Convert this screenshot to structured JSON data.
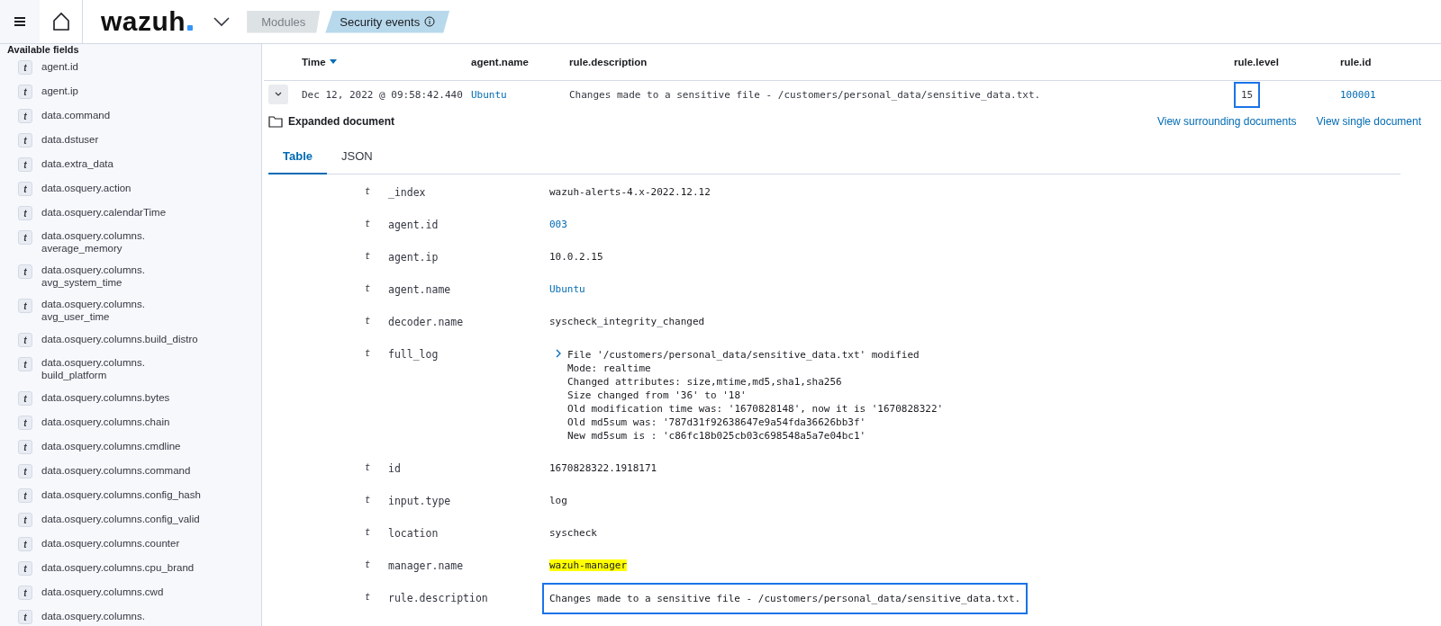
{
  "header": {
    "brand": "wazuh",
    "breadcrumbs": [
      {
        "label": "Modules",
        "selected": false
      },
      {
        "label": "Security events",
        "selected": true
      }
    ]
  },
  "sidebar": {
    "title": "Available fields",
    "fields": [
      {
        "type": "t",
        "lines": [
          "agent.id"
        ]
      },
      {
        "type": "t",
        "lines": [
          "agent.ip"
        ]
      },
      {
        "type": "t",
        "lines": [
          "data.command"
        ]
      },
      {
        "type": "t",
        "lines": [
          "data.dstuser"
        ]
      },
      {
        "type": "t",
        "lines": [
          "data.extra_data"
        ]
      },
      {
        "type": "t",
        "lines": [
          "data.osquery.action"
        ]
      },
      {
        "type": "t",
        "lines": [
          "data.osquery.calendarTime"
        ]
      },
      {
        "type": "t",
        "lines": [
          "data.osquery.columns.",
          "average_memory"
        ]
      },
      {
        "type": "t",
        "lines": [
          "data.osquery.columns.",
          "avg_system_time"
        ]
      },
      {
        "type": "t",
        "lines": [
          "data.osquery.columns.",
          "avg_user_time"
        ]
      },
      {
        "type": "t",
        "lines": [
          "data.osquery.columns.build_distro"
        ]
      },
      {
        "type": "t",
        "lines": [
          "data.osquery.columns.",
          "build_platform"
        ]
      },
      {
        "type": "t",
        "lines": [
          "data.osquery.columns.bytes"
        ]
      },
      {
        "type": "t",
        "lines": [
          "data.osquery.columns.chain"
        ]
      },
      {
        "type": "t",
        "lines": [
          "data.osquery.columns.cmdline"
        ]
      },
      {
        "type": "t",
        "lines": [
          "data.osquery.columns.command"
        ]
      },
      {
        "type": "t",
        "lines": [
          "data.osquery.columns.config_hash"
        ]
      },
      {
        "type": "t",
        "lines": [
          "data.osquery.columns.config_valid"
        ]
      },
      {
        "type": "t",
        "lines": [
          "data.osquery.columns.counter"
        ]
      },
      {
        "type": "t",
        "lines": [
          "data.osquery.columns.cpu_brand"
        ]
      },
      {
        "type": "t",
        "lines": [
          "data.osquery.columns.cwd"
        ]
      },
      {
        "type": "t",
        "lines": [
          "data.osquery.columns."
        ]
      }
    ]
  },
  "table": {
    "columns": [
      {
        "label": "Time",
        "sorted": true
      },
      {
        "label": "agent.name",
        "sorted": false
      },
      {
        "label": "rule.description",
        "sorted": false
      },
      {
        "label": "rule.level",
        "sorted": false
      },
      {
        "label": "rule.id",
        "sorted": false
      }
    ],
    "rows": [
      {
        "expanded": true,
        "cells": [
          {
            "kind": "text",
            "text": "Dec 12, 2022 @ 09:58:42.440",
            "outlined": false
          },
          {
            "kind": "link",
            "text": "Ubuntu",
            "outlined": false
          },
          {
            "kind": "text",
            "text": "Changes made to a sensitive file - /customers/personal_data/sensitive_data.txt.",
            "outlined": false
          },
          {
            "kind": "text",
            "text": "15",
            "outlined": true
          },
          {
            "kind": "link",
            "text": "100001",
            "outlined": false
          }
        ]
      }
    ]
  },
  "document": {
    "title": "Expanded document",
    "links": [
      "View surrounding documents",
      "View single document"
    ],
    "tabs": [
      {
        "label": "Table",
        "selected": true
      },
      {
        "label": "JSON",
        "selected": false
      }
    ],
    "fields": [
      {
        "type": "t",
        "name": "_index",
        "kind": "text",
        "value": [
          "wazuh-alerts-4.x-2022.12.12"
        ],
        "highlighted": false,
        "outlined": false
      },
      {
        "type": "t",
        "name": "agent.id",
        "kind": "link",
        "value": [
          "003"
        ],
        "highlighted": false,
        "outlined": false
      },
      {
        "type": "t",
        "name": "agent.ip",
        "kind": "text",
        "value": [
          "10.0.2.15"
        ],
        "highlighted": false,
        "outlined": false
      },
      {
        "type": "t",
        "name": "agent.name",
        "kind": "link",
        "value": [
          "Ubuntu"
        ],
        "highlighted": false,
        "outlined": false
      },
      {
        "type": "t",
        "name": "decoder.name",
        "kind": "text",
        "value": [
          "syscheck_integrity_changed"
        ],
        "highlighted": false,
        "outlined": false
      },
      {
        "type": "t",
        "name": "full_log",
        "kind": "log",
        "value": [
          "File '/customers/personal_data/sensitive_data.txt' modified",
          "Mode: realtime",
          "Changed attributes: size,mtime,md5,sha1,sha256",
          "Size changed from '36' to '18'",
          "Old modification time was: '1670828148', now it is '1670828322'",
          "Old md5sum was: '787d31f92638647e9a54fda36626bb3f'",
          "New md5sum is : 'c86fc18b025cb03c698548a5a7e04bc1'"
        ]
      },
      {
        "type": "t",
        "name": "id",
        "kind": "text",
        "value": [
          "1670828322.1918171"
        ],
        "highlighted": false,
        "outlined": false
      },
      {
        "type": "t",
        "name": "input.type",
        "kind": "text",
        "value": [
          "log"
        ],
        "highlighted": false,
        "outlined": false
      },
      {
        "type": "t",
        "name": "location",
        "kind": "text",
        "value": [
          "syscheck"
        ],
        "highlighted": false,
        "outlined": false
      },
      {
        "type": "t",
        "name": "manager.name",
        "kind": "text",
        "value": [
          "wazuh-manager"
        ],
        "highlighted": true,
        "outlined": false
      },
      {
        "type": "t",
        "name": "rule.description",
        "kind": "text",
        "value": [
          "Changes made to a sensitive file - /customers/personal_data/sensitive_data.txt."
        ],
        "highlighted": false,
        "outlined": true
      }
    ]
  }
}
